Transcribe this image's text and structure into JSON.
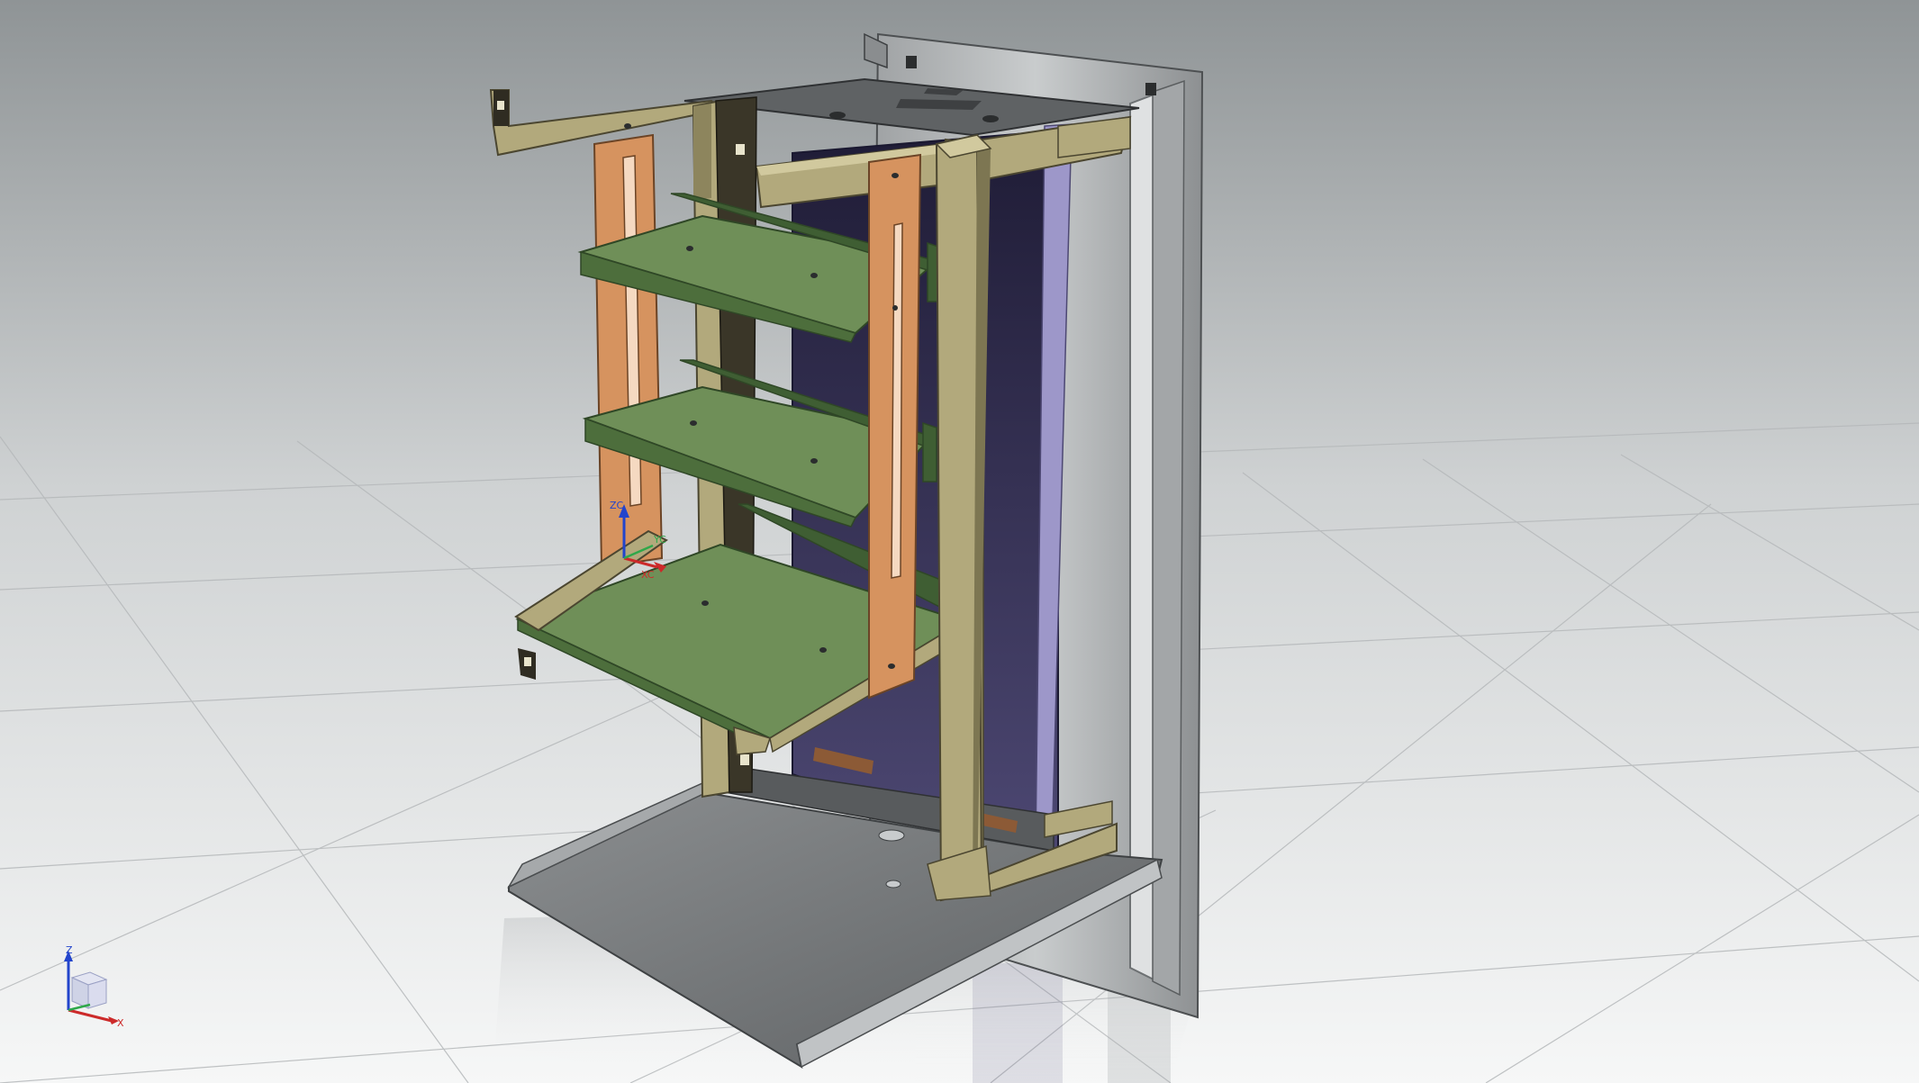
{
  "viewport": {
    "background_top": "#8f9496",
    "background_bottom": "#f4f5f5",
    "grid_color": "#b9bcbe"
  },
  "model": {
    "colors": {
      "frame": "#b2a97c",
      "frame_dark": "#6b6445",
      "shelf": "#6f8f58",
      "shelf_dark": "#3f5e33",
      "rail": "#d6935f",
      "rail_dark": "#8c5a36",
      "back_panel": "#2d2a4a",
      "back_panel_light": "#55507a",
      "housing": "#b8bbbd",
      "housing_dark": "#6d7173",
      "floor": "#7b7e80",
      "glass": "#9d97c9"
    }
  },
  "view_triad": {
    "z_label": "Z",
    "x_label": "X",
    "z_color": "#2244cc",
    "x_color": "#cc2a2a",
    "y_color": "#2fa84a"
  },
  "part_triad": {
    "z_label": "ZC",
    "x_label": "XC",
    "y_label": "YC"
  }
}
